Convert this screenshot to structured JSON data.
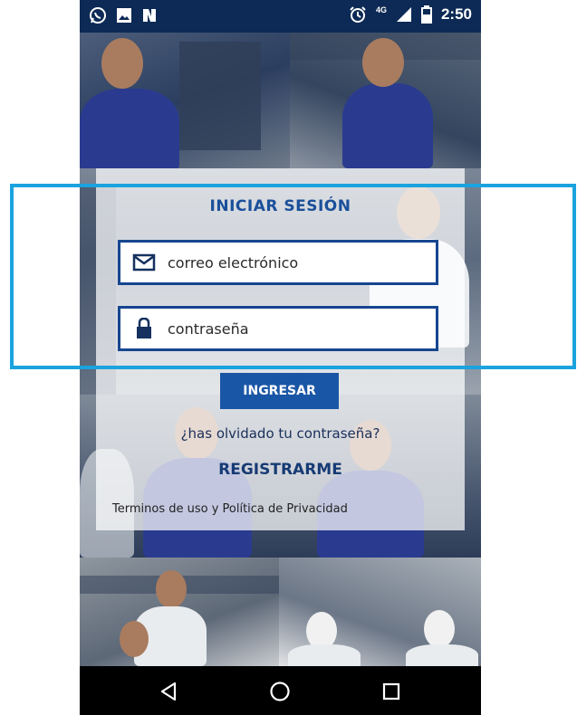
{
  "status_bar": {
    "time": "2:50",
    "network": "4G",
    "left_icons": [
      "whatsapp-icon",
      "image-icon",
      "n-notification-icon"
    ],
    "right_icons": [
      "alarm-icon",
      "signal-icon",
      "battery-icon"
    ]
  },
  "login": {
    "title": "INICIAR SESIÓN",
    "email_placeholder": "correo electrónico",
    "password_placeholder": "contraseña",
    "submit_label": "INGRESAR",
    "forgot_link": "¿has olvidado tu contraseña?",
    "register_link": "REGISTRARME",
    "terms_link": "Terminos de uso y Política de Privacidad"
  },
  "navigation": {
    "buttons": [
      "back-icon",
      "home-icon",
      "recents-icon"
    ]
  },
  "colors": {
    "status_bar": "#0c2a55",
    "accent_blue": "#1a56a6",
    "field_border": "#16468f",
    "highlight": "#1aa3de"
  }
}
